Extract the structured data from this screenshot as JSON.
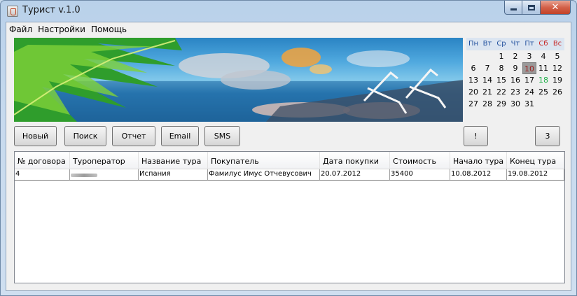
{
  "window": {
    "title": "Турист v.1.0",
    "controls": {
      "minimize": "",
      "maximize": "",
      "close": "✕"
    }
  },
  "menu": [
    "Файл",
    "Настройки",
    "Помощь"
  ],
  "calendar": {
    "weekdays": [
      "Пн",
      "Вт",
      "Ср",
      "Чт",
      "Пт",
      "Сб",
      "Вс"
    ],
    "weeks": [
      [
        "",
        "",
        "1",
        "2",
        "3",
        "4",
        "5"
      ],
      [
        "6",
        "7",
        "8",
        "9",
        "10",
        "11",
        "12"
      ],
      [
        "13",
        "14",
        "15",
        "16",
        "17",
        "18",
        "19"
      ],
      [
        "20",
        "21",
        "22",
        "23",
        "24",
        "25",
        "26"
      ],
      [
        "27",
        "28",
        "29",
        "30",
        "31",
        "",
        ""
      ]
    ],
    "selected_day": "10",
    "highlighted_day": "18",
    "colors": {
      "weekday": "#1f4e9c",
      "weekend": "#c62828",
      "selected": "#9a9a9a",
      "highlighted": "#21b04a"
    }
  },
  "toolbar": {
    "new": "Новый",
    "search": "Поиск",
    "report": "Отчет",
    "email": "Email",
    "sms": "SMS",
    "alert": "!",
    "count": "3"
  },
  "table": {
    "columns": [
      "№ договора",
      "Туроператор",
      "Название тура",
      "Покупатель",
      "Дата покупки",
      "Стоимость",
      "Начало тура",
      "Конец тура"
    ],
    "rows": [
      [
        "4",
        "",
        "Испания",
        "Фамилус Имус Отчевусович",
        "20.07.2012",
        "35400",
        "10.08.2012",
        "19.08.2012"
      ]
    ]
  }
}
